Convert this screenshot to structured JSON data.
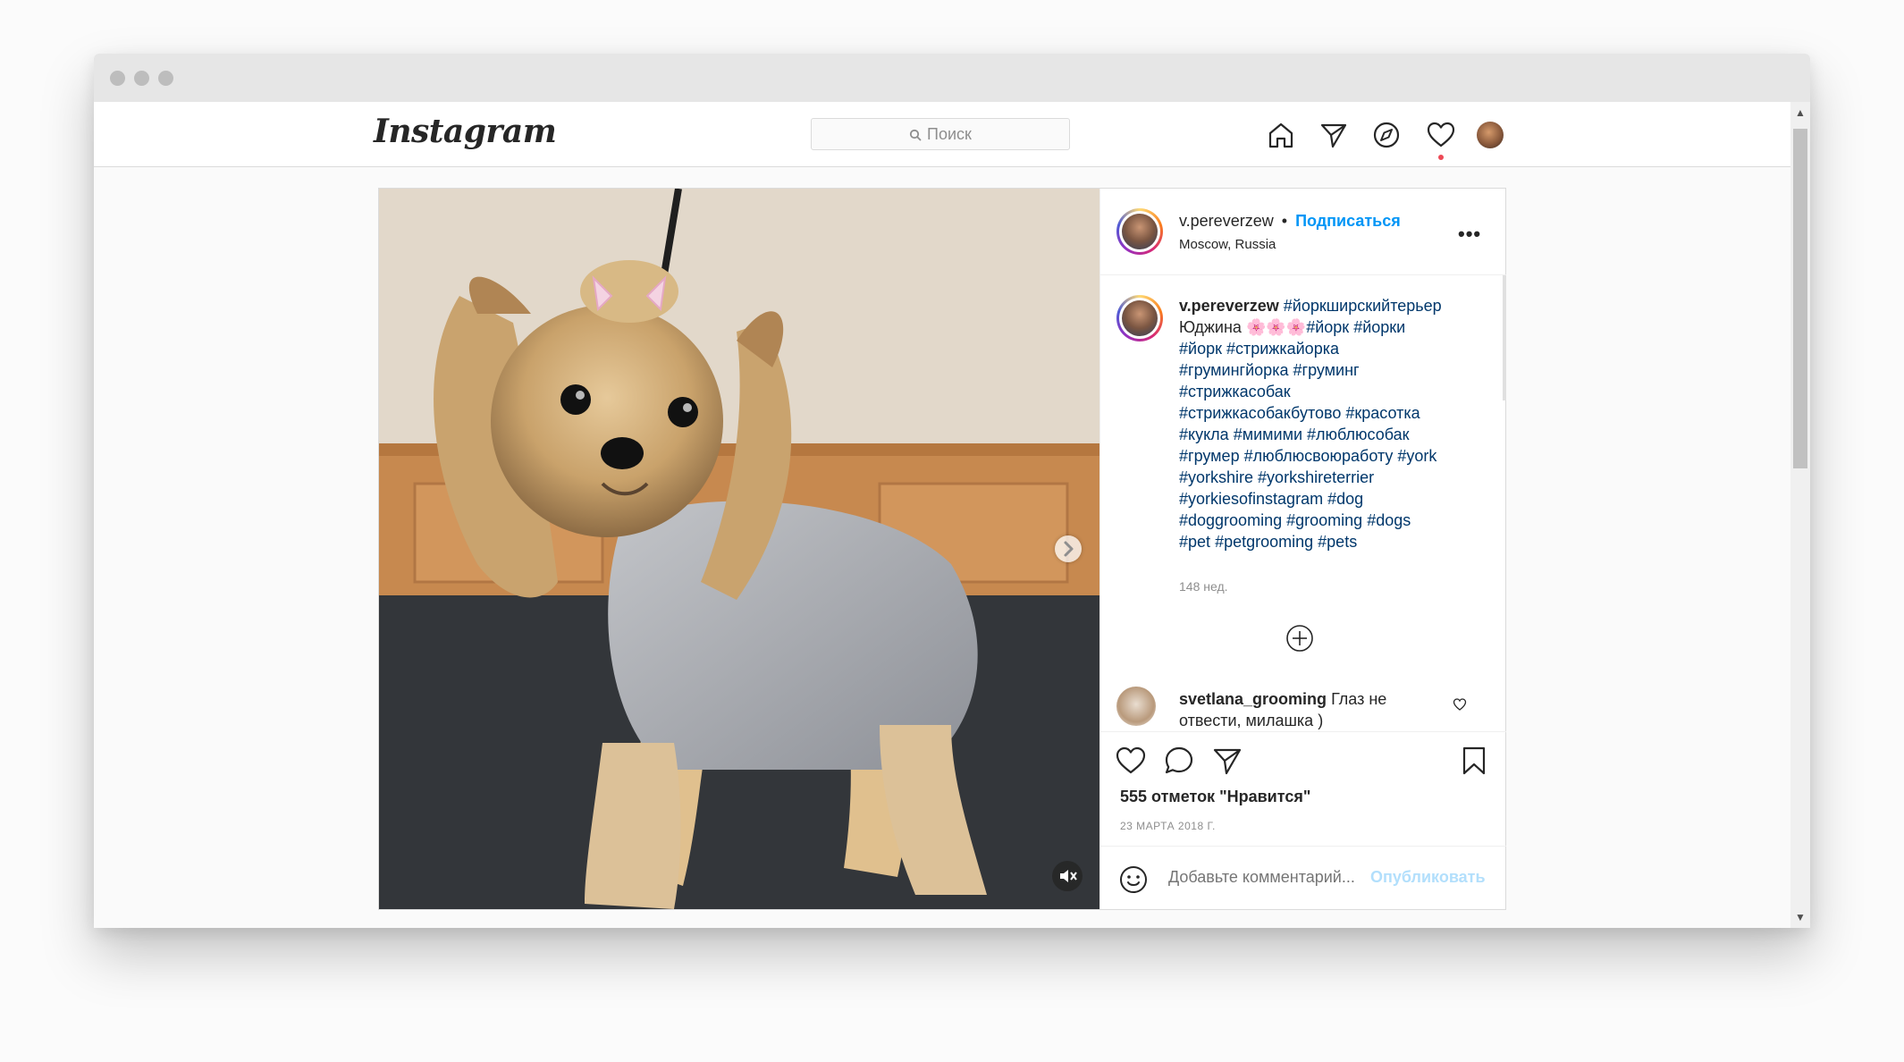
{
  "window": {
    "dots": [
      "close",
      "minimize",
      "maximize"
    ]
  },
  "nav": {
    "logo": "Instagram",
    "search_placeholder": "Поиск",
    "icons": [
      "home-icon",
      "direct-icon",
      "explore-icon",
      "activity-heart-icon",
      "profile-avatar"
    ]
  },
  "post": {
    "author": {
      "username": "v.pereverzew",
      "follow_label": "Подписаться",
      "separator": "•",
      "location": "Moscow, Russia"
    },
    "more_label": "•••",
    "caption": {
      "username": "v.pereverzew",
      "line1_tag": "#йоркширскийтерьер",
      "name": "Юджина",
      "flowers": "🌸🌸🌸",
      "tags": [
        "#йорк",
        "#йорки",
        "#йорк",
        "#стрижкайорка",
        "#грумингйорка",
        "#груминг",
        "#стрижкасобак",
        "#стрижкасобакбутово",
        "#красотка",
        "#кукла",
        "#мимими",
        "#люблюсобак",
        "#грумер",
        "#люблюсвоюработу",
        "#york",
        "#yorkshire",
        "#yorkshireterrier",
        "#yorkiesofinstagram",
        "#dog",
        "#doggrooming",
        "#grooming",
        "#dogs",
        "#pet",
        "#petgrooming",
        "#pets"
      ],
      "time": "148 нед."
    },
    "comments": [
      {
        "username": "svetlana_grooming",
        "text": "Глаз не отвести, милашка )"
      }
    ],
    "likes": "555 отметок \"Нравится\"",
    "date": "23 МАРТА 2018 Г.",
    "composer": {
      "placeholder": "Добавьте комментарий...",
      "publish_label": "Опубликовать"
    },
    "media": {
      "type": "video",
      "subject": "yorkshire terrier dog on grooming table",
      "muted": true
    }
  },
  "colors": {
    "link": "#0095f6",
    "tag": "#00376b",
    "text": "#262626",
    "muted": "#8e8e8e",
    "border": "#dbdbdb",
    "notification": "#ed4956"
  }
}
